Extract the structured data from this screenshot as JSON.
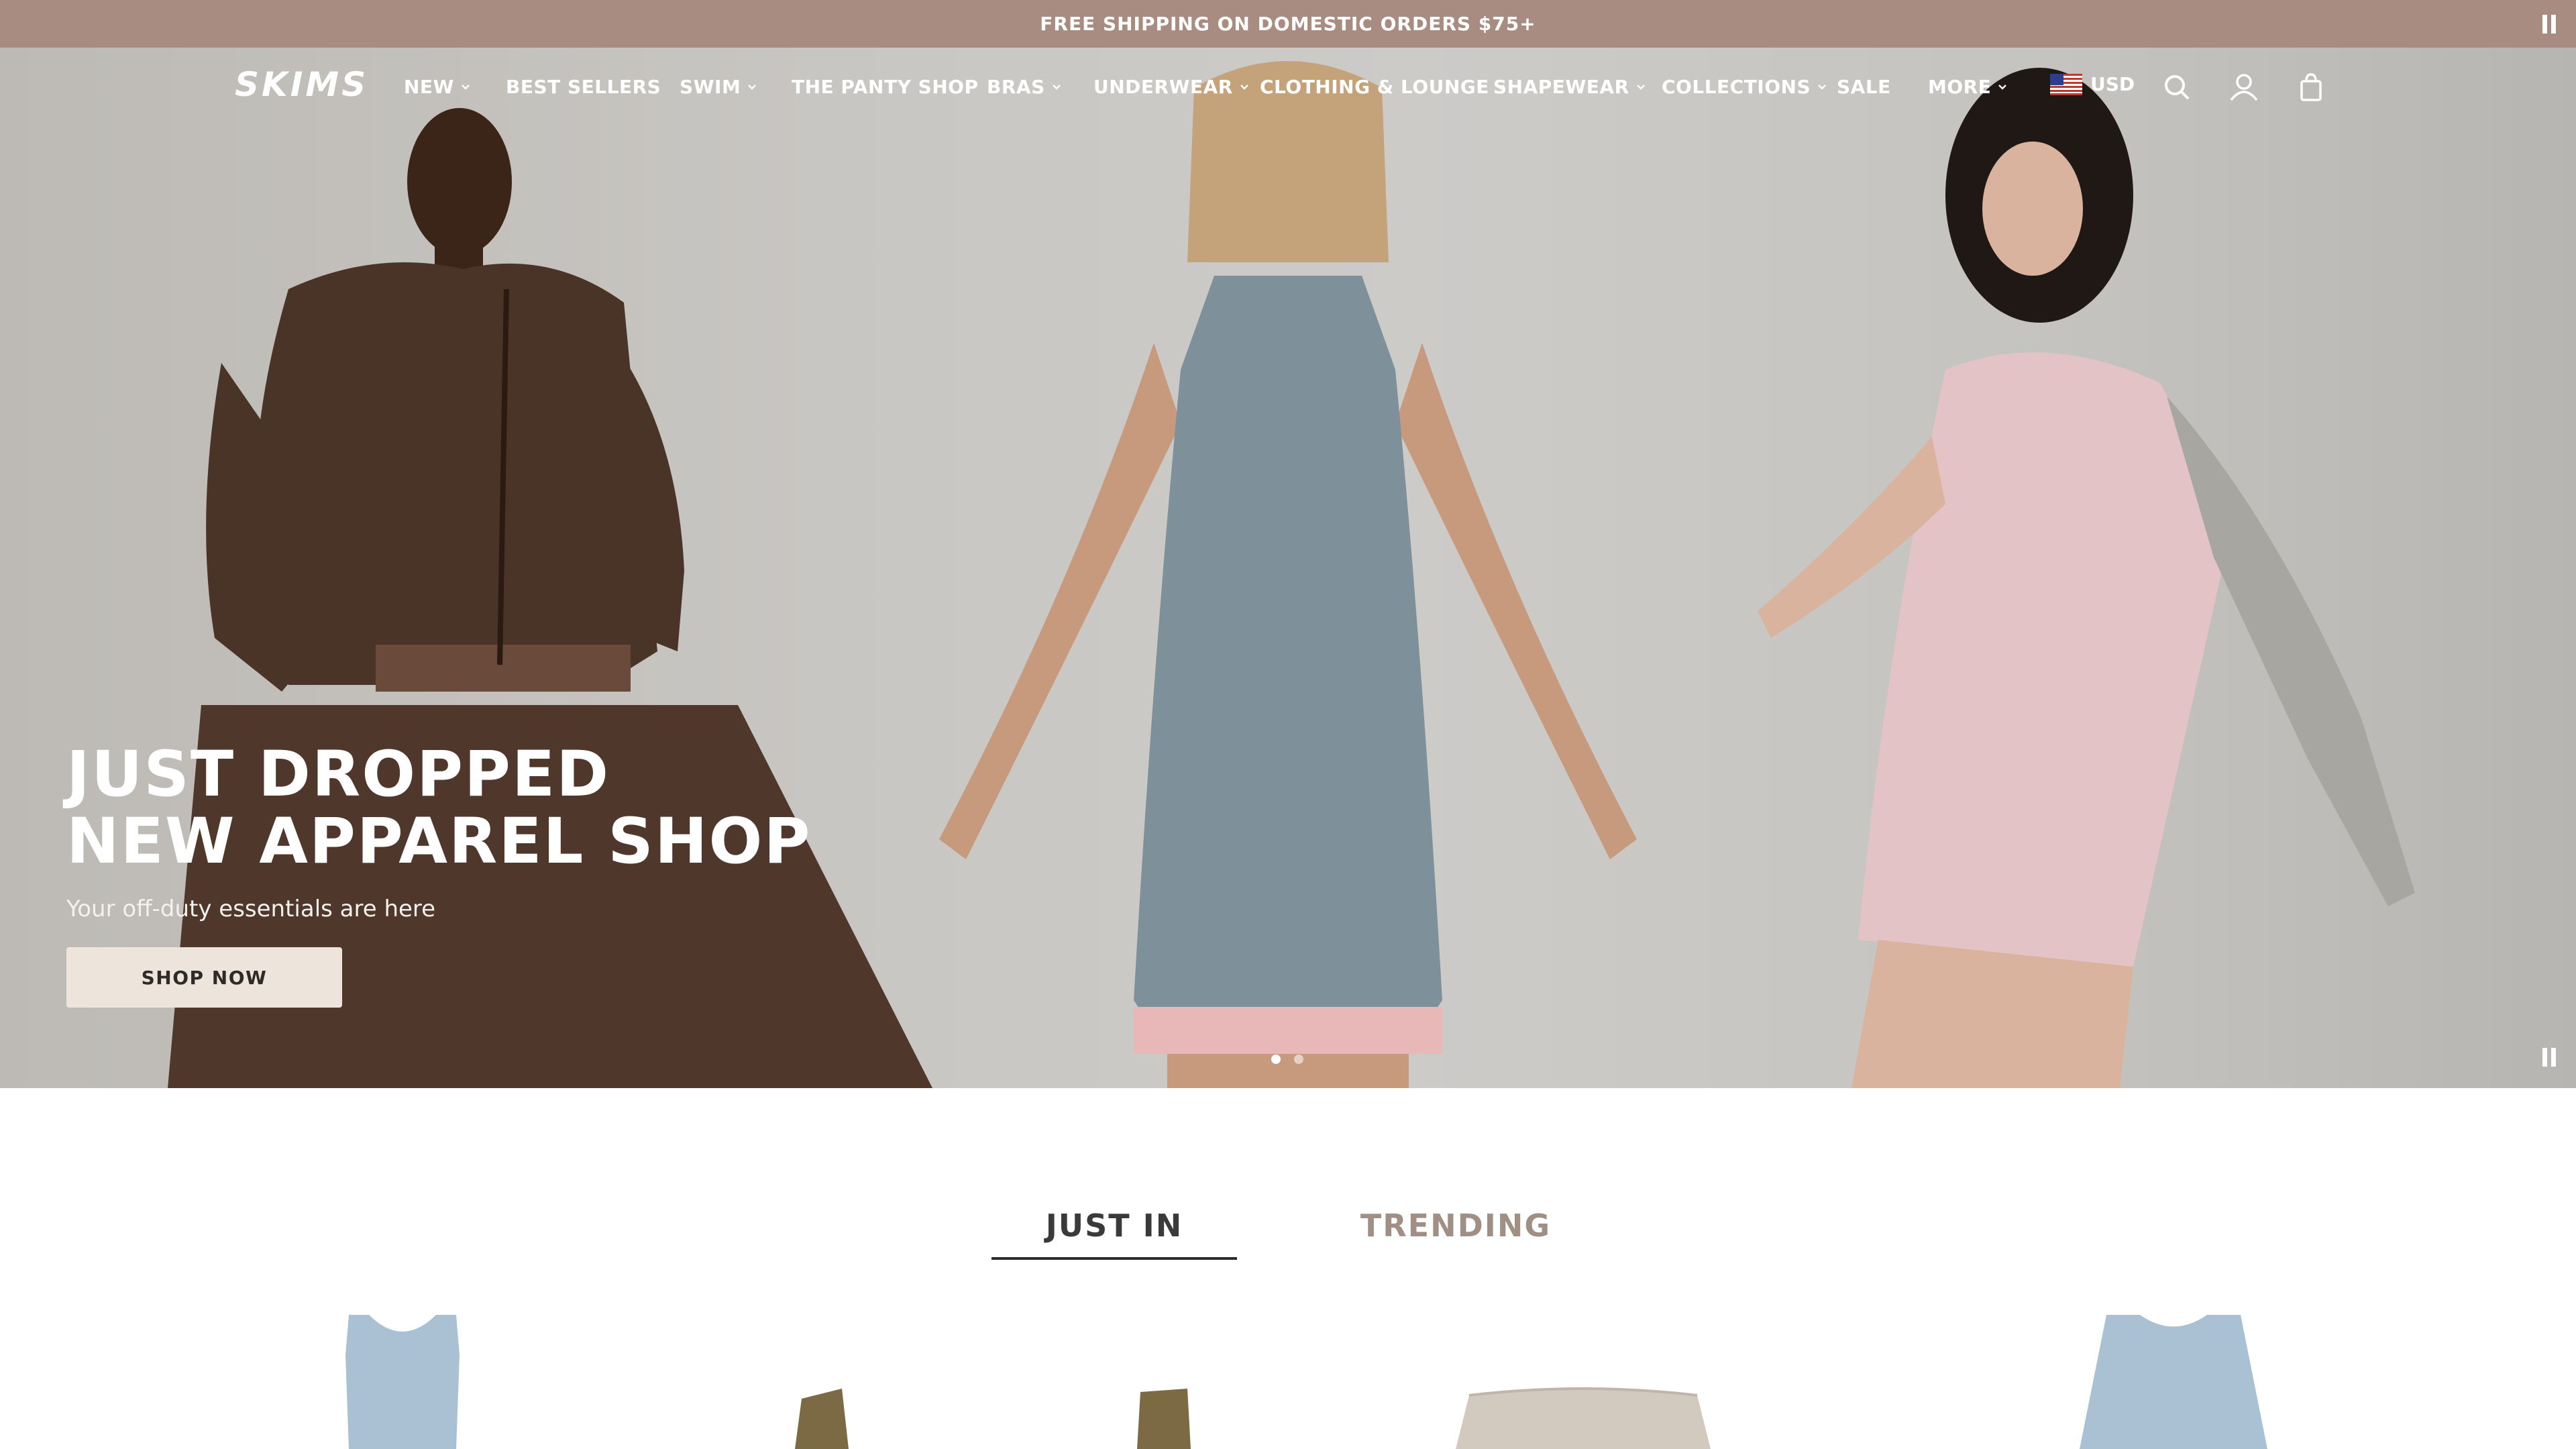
{
  "announcement": {
    "text": "FREE SHIPPING ON DOMESTIC ORDERS $75+",
    "pause_icon": "pause-icon"
  },
  "header": {
    "logo": "SKIMS",
    "nav": [
      {
        "label": "NEW",
        "has_dropdown": true
      },
      {
        "label": "BEST SELLERS",
        "has_dropdown": false
      },
      {
        "label": "SWIM",
        "has_dropdown": true
      },
      {
        "label": "THE PANTY SHOP",
        "has_dropdown": false
      },
      {
        "label": "BRAS",
        "has_dropdown": true
      },
      {
        "label": "UNDERWEAR",
        "has_dropdown": true
      },
      {
        "label": "CLOTHING & LOUNGE",
        "has_dropdown": true
      },
      {
        "label": "SHAPEWEAR",
        "has_dropdown": true
      },
      {
        "label": "COLLECTIONS",
        "has_dropdown": true
      },
      {
        "label": "SALE",
        "has_dropdown": false
      },
      {
        "label": "MORE",
        "has_dropdown": true
      }
    ],
    "currency": "USD",
    "icons": [
      "us-flag-icon",
      "search-icon",
      "account-icon",
      "bag-icon"
    ]
  },
  "hero": {
    "title_line1": "JUST DROPPED",
    "title_line2": "NEW APPAREL SHOP",
    "subtitle": "Your off-duty essentials are here",
    "cta": "SHOP NOW",
    "slide_count": 2,
    "active_slide": 1
  },
  "tabs": [
    {
      "label": "JUST IN",
      "active": true
    },
    {
      "label": "TRENDING",
      "active": false
    }
  ],
  "colors": {
    "announcement_bg": "#a98c81",
    "cta_bg": "#ede4dc",
    "tab_inactive": "#a08f84"
  }
}
